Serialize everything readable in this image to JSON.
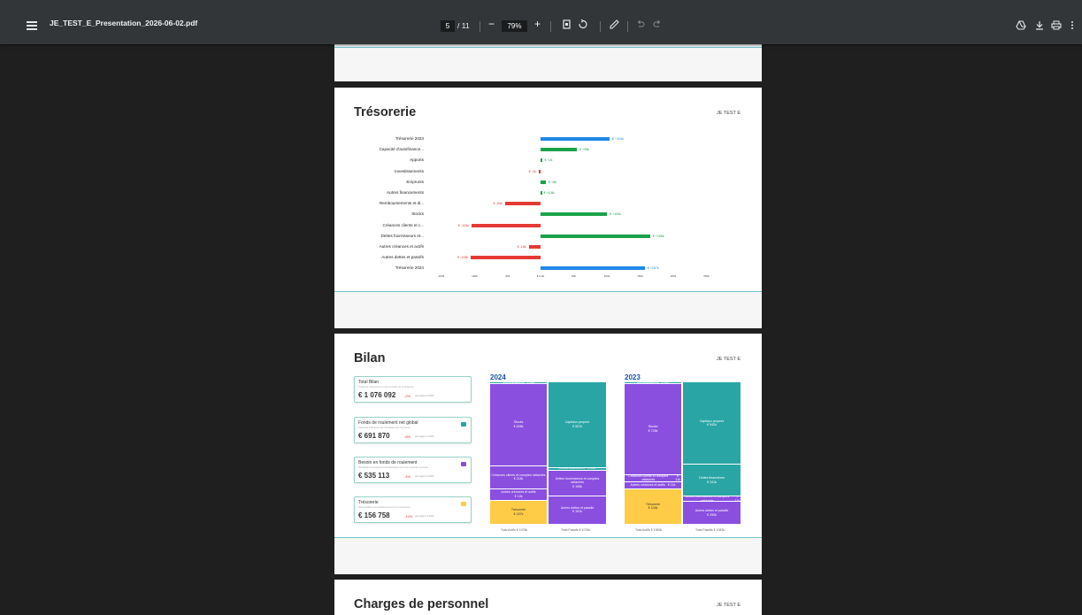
{
  "toolbar": {
    "file_name": "JE_TEST_E_Presentation_2026-06-02.pdf",
    "current_page": "5",
    "page_count": "/ 11",
    "zoom_out": "−",
    "zoom": "79%",
    "zoom_in": "+",
    "icons": [
      "menu-icon",
      "zoom-out-icon",
      "zoom-in-icon",
      "fit-page-icon",
      "rotate-icon",
      "annotate-icon",
      "undo-icon",
      "redo-icon",
      "save-drive-icon",
      "download-icon",
      "print-icon",
      "more-icon"
    ]
  },
  "tresorerie_page": {
    "title": "Trésorerie",
    "brand": "JE TEST E",
    "rows": [
      {
        "label": "Trésorerie 2023",
        "value": 104,
        "value_label": "€ +104k",
        "kind": "total"
      },
      {
        "label": "Capacité d'autofinance...",
        "value": 55,
        "value_label": "€ +55k",
        "kind": "pos"
      },
      {
        "label": "Apports",
        "value": 2,
        "value_label": "€ +2k",
        "kind": "pos"
      },
      {
        "label": "Investissements",
        "value": -3,
        "value_label": "€ -3k",
        "kind": "neg"
      },
      {
        "label": "Emprunts",
        "value": 8,
        "value_label": "€ +8k",
        "kind": "pos"
      },
      {
        "label": "Autres financements",
        "value": 0.8,
        "value_label": "€ +0,8k",
        "kind": "pos"
      },
      {
        "label": "Remboursements et di...",
        "value": -54,
        "value_label": "€ -54k",
        "kind": "neg"
      },
      {
        "label": "Stocks",
        "value": 100,
        "value_label": "€ +100k",
        "kind": "pos"
      },
      {
        "label": "Créances clients et c...",
        "value": -104,
        "value_label": "€ -104k",
        "kind": "neg"
      },
      {
        "label": "Dettes fournisseurs et...",
        "value": 165,
        "value_label": "€ +165k",
        "kind": "pos"
      },
      {
        "label": "Autres créances et actifs",
        "value": -18,
        "value_label": "€ -18k",
        "kind": "neg"
      },
      {
        "label": "Autres dettes et passifs",
        "value": -105,
        "value_label": "€ -105k",
        "kind": "neg"
      },
      {
        "label": "Trésorerie 2024",
        "value": 157,
        "value_label": "€ +157k",
        "kind": "total"
      }
    ],
    "ticks": [
      "-150k",
      "-100k",
      "-50k",
      "€ 0.0k",
      "50k",
      "100k",
      "150k",
      "200k",
      "250k"
    ],
    "tick_values": [
      -150,
      -100,
      -50,
      0,
      50,
      100,
      150,
      200,
      250
    ],
    "colors": {
      "total": "#1e88e5",
      "pos": "#1aa34a",
      "neg": "#e53935"
    }
  },
  "bilan_page": {
    "title": "Bilan",
    "brand": "JE TEST E",
    "kpis": [
      {
        "title": "Total Bilan",
        "subtitle": "Total des ressources et des emplois de l'entreprise",
        "value": "€ 1 076 092",
        "delta": "-2%",
        "compare": "par rapport à 2023",
        "badge_color": ""
      },
      {
        "title": "Fonds de roulement net global",
        "subtitle": "Capacité à financer les décalages de trésorerie",
        "value": "€ 691 870",
        "delta": "-8%",
        "compare": "par rapport à 2023",
        "badge_color": "#2aa5a5"
      },
      {
        "title": "Besoin en fonds de roulement",
        "subtitle": "Décalage d'encaissements/décaissements de l'activité courante",
        "value": "€ 535 113",
        "delta": "-4%",
        "compare": "par rapport à 2023",
        "badge_color": "#8b4fe0"
      },
      {
        "title": "Trésorerie",
        "subtitle": "Disponibilités immédiatement à la fin d'exercice",
        "value": "€ 156 758",
        "delta": "-19%",
        "compare": "par rapport à 2023",
        "badge_color": "#ffcc47"
      }
    ],
    "colors": {
      "teal": "#2aa5a5",
      "purple": "#8b4fe0",
      "yellow": "#ffcc47"
    },
    "year_2024": {
      "year": "2024",
      "actif": [
        {
          "label": "Immobilisations",
          "value": "€ 12k",
          "color": "teal",
          "share": 1
        },
        {
          "label": "Stocks",
          "value": "€ 626k",
          "color": "purple",
          "share": 58
        },
        {
          "label": "Créances clients et comptes rattachés",
          "value": "€ 114k",
          "color": "purple",
          "share": 16
        },
        {
          "label": "Autres créances et actifs",
          "value": "€ 12k",
          "color": "purple",
          "share": 8
        },
        {
          "label": "Trésorerie",
          "value": "€ 157k",
          "color": "yellow",
          "share": 17
        }
      ],
      "passif": [
        {
          "label": "Capitaux propres",
          "value": "€ 557k",
          "color": "teal",
          "share": 60
        },
        {
          "label": "Dettes financières",
          "value": "€ 23k",
          "color": "teal",
          "share": 2
        },
        {
          "label": "Dettes fournisseurs et comptes rattachés",
          "value": "€ 195k",
          "color": "purple",
          "share": 18
        },
        {
          "label": "Autres dettes et passifs",
          "value": "€ 151k",
          "color": "purple",
          "share": 20
        }
      ],
      "foot_actif": "Total Actifs € 1076k",
      "foot_passif": "Total Passifs € 1076k"
    },
    "year_2023": {
      "year": "2023",
      "actif": [
        {
          "label": "Immobilisations",
          "value": "€ 11k",
          "color": "teal",
          "share": 1
        },
        {
          "label": "Stocks",
          "value": "€ 726k",
          "color": "purple",
          "share": 64
        },
        {
          "label": "Créances clients et comptes rattachés",
          "value": "€ 11k",
          "color": "purple",
          "share": 5
        },
        {
          "label": "Autres créances et actifs",
          "value": "€ 11k",
          "color": "purple",
          "share": 5
        },
        {
          "label": "Trésorerie",
          "value": "€ 104k",
          "color": "yellow",
          "share": 25
        }
      ],
      "passif": [
        {
          "label": "Capitaux propres",
          "value": "€ 542k",
          "color": "teal",
          "share": 58
        },
        {
          "label": "Dettes financières",
          "value": "€ 341k",
          "color": "teal",
          "share": 22
        },
        {
          "label": "Dettes fournisseurs et comptes rattachés",
          "value": "€ 11k",
          "color": "purple",
          "share": 4
        },
        {
          "label": "Autres dettes et passifs",
          "value": "€ 250k",
          "color": "purple",
          "share": 16
        }
      ],
      "foot_actif": "Total Actifs € 1083k",
      "foot_passif": "Total Passifs € 1083k"
    }
  },
  "charges_page": {
    "title": "Charges de personnel",
    "brand": "JE TEST E"
  }
}
